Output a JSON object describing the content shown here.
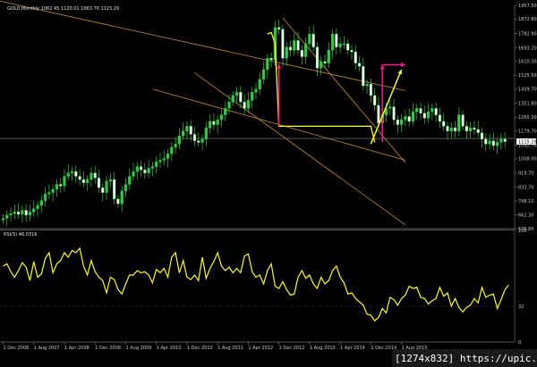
{
  "chart_data": [
    {
      "type": "candlestick",
      "symbol_header": "GOLD,Monthly  1062.45 1120.01 1063.70 1115.29",
      "current_price_label": "1115.29",
      "y_ticks": [
        "1957.50",
        "1872.80",
        "1782.90",
        "1693.20",
        "1610.30",
        "1525.50",
        "1439.70",
        "1351.80",
        "1265.50",
        "1179.70",
        "1092.70",
        "1008.00",
        "919.70",
        "833.70",
        "748.10",
        "662.30",
        "576.80"
      ],
      "ylim": [
        576.8,
        1957.5
      ],
      "x_ticks": [
        "1 Dec 2006",
        "1 Aug 2007",
        "1 Apr 2008",
        "1 Dec 2008",
        "1 Aug 2009",
        "1 Apr 2010",
        "1 Dec 2010",
        "1 Aug 2011",
        "1 Apr 2012",
        "1 Dec 2012",
        "1 Aug 2013",
        "1 Apr 2014",
        "1 Dec 2014",
        "1 Aug 2015"
      ],
      "trend_lines": [
        {
          "from": [
            "Oct 2006",
            1990
          ],
          "to": [
            "Sep 2015",
            1430
          ]
        },
        {
          "from": [
            "Mar 2010",
            1440
          ],
          "to": [
            "Sep 2015",
            1000
          ]
        },
        {
          "from": [
            "Feb 2011",
            1540
          ],
          "to": [
            "Sep 2015",
            600
          ]
        },
        {
          "from": [
            "Jan 2013",
            1880
          ],
          "to": [
            "Sep 2015",
            985
          ]
        }
      ],
      "horizontal_line": 1134,
      "arrows": [
        {
          "color": "#ff1493",
          "from": [
            "Dec 2012",
            1210
          ],
          "to": [
            "Dec 2012",
            1595
          ]
        },
        {
          "color": "#ff1493",
          "from": [
            "Mar 2015",
            1115
          ],
          "to": [
            "Mar 2015",
            1590
          ]
        },
        {
          "color": "#ff1493",
          "from": [
            "Mar 2015",
            1590
          ],
          "to": [
            "Sep 2015",
            1590
          ]
        },
        {
          "color": "#ffff00",
          "from": [
            "Dec 2014",
            1100
          ],
          "to": [
            "Aug 2015",
            1560
          ]
        }
      ],
      "yellow_path": [
        [
          "Sep 2012",
          1780
        ],
        [
          "Oct 2012",
          1790
        ],
        [
          "Nov 2012",
          1720
        ],
        [
          "Dec 2012",
          1210
        ],
        [
          "Dec 2014",
          1210
        ],
        [
          "Jan 2015",
          1110
        ]
      ]
    },
    {
      "type": "line",
      "title": "RSI(5) 46.0316",
      "y_ticks": [
        "100",
        "32",
        "0"
      ],
      "ylim": [
        0,
        100
      ],
      "level_line": 32,
      "series": [
        {
          "values": [
            68,
            70,
            63,
            58,
            64,
            71,
            67,
            55,
            72,
            58,
            61,
            75,
            80,
            62,
            70,
            73,
            80,
            76,
            82,
            80,
            84,
            68,
            60,
            73,
            63,
            58,
            55,
            44,
            58,
            56,
            47,
            43,
            52,
            60,
            60,
            64,
            62,
            63,
            60,
            53,
            65,
            62,
            66,
            58,
            76,
            80,
            62,
            73,
            58,
            56,
            60,
            55,
            76,
            57,
            66,
            72,
            80,
            68,
            64,
            67,
            62,
            66,
            62,
            77,
            79,
            63,
            58,
            60,
            52,
            64,
            70,
            50,
            48,
            54,
            47,
            42,
            43,
            58,
            64,
            57,
            60,
            52,
            48,
            58,
            52,
            55,
            64,
            68,
            58,
            53,
            43,
            44,
            39,
            36,
            33,
            25,
            24,
            19,
            22,
            30,
            26,
            40,
            38,
            33,
            39,
            42,
            50,
            48,
            49,
            40,
            39,
            34,
            37,
            39,
            49,
            41,
            44,
            32,
            39,
            31,
            27,
            31,
            33,
            39,
            35,
            49,
            40,
            42,
            43,
            30,
            38,
            47,
            51
          ]
        }
      ]
    }
  ]
}
